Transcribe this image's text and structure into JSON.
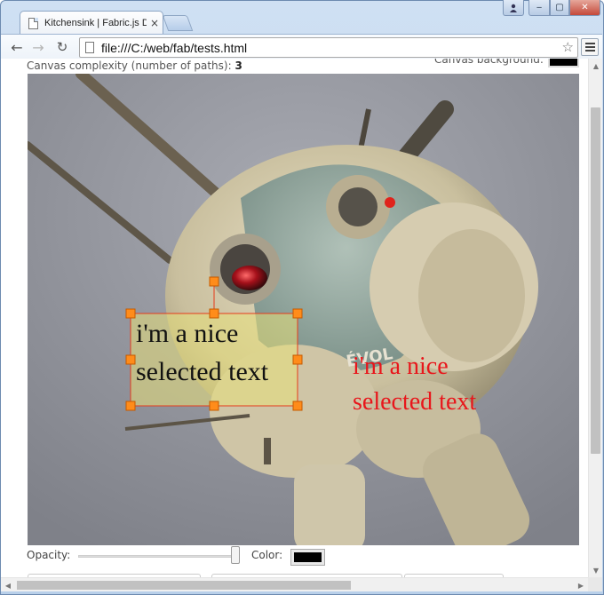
{
  "browser": {
    "tab_title": "Kitchensink | Fabric.js Demo",
    "tab_close": "×",
    "url": "file:///C:/web/fab/tests.html",
    "controls": {
      "minimize": "‒",
      "maximize": "▢",
      "close": "✕",
      "user": "👤"
    }
  },
  "page": {
    "complexity_label": "Canvas complexity (number of paths):",
    "complexity_value": "3",
    "bg_label": "Canvas background:",
    "bg_color": "#000000",
    "opacity_label": "Opacity:",
    "opacity_value": 1,
    "color_label": "Color:",
    "color_value": "#000000"
  },
  "canvas": {
    "selected_text": {
      "line1": "i'm a nice",
      "line2": "selected text",
      "color": "#111111",
      "highlight": "#e8e07a"
    },
    "red_text": {
      "line1": "i'm a nice",
      "line2": "selected text",
      "color": "#e8161b"
    },
    "selection_color": "#e63a1a",
    "handle_color": "#ff8c1a"
  }
}
